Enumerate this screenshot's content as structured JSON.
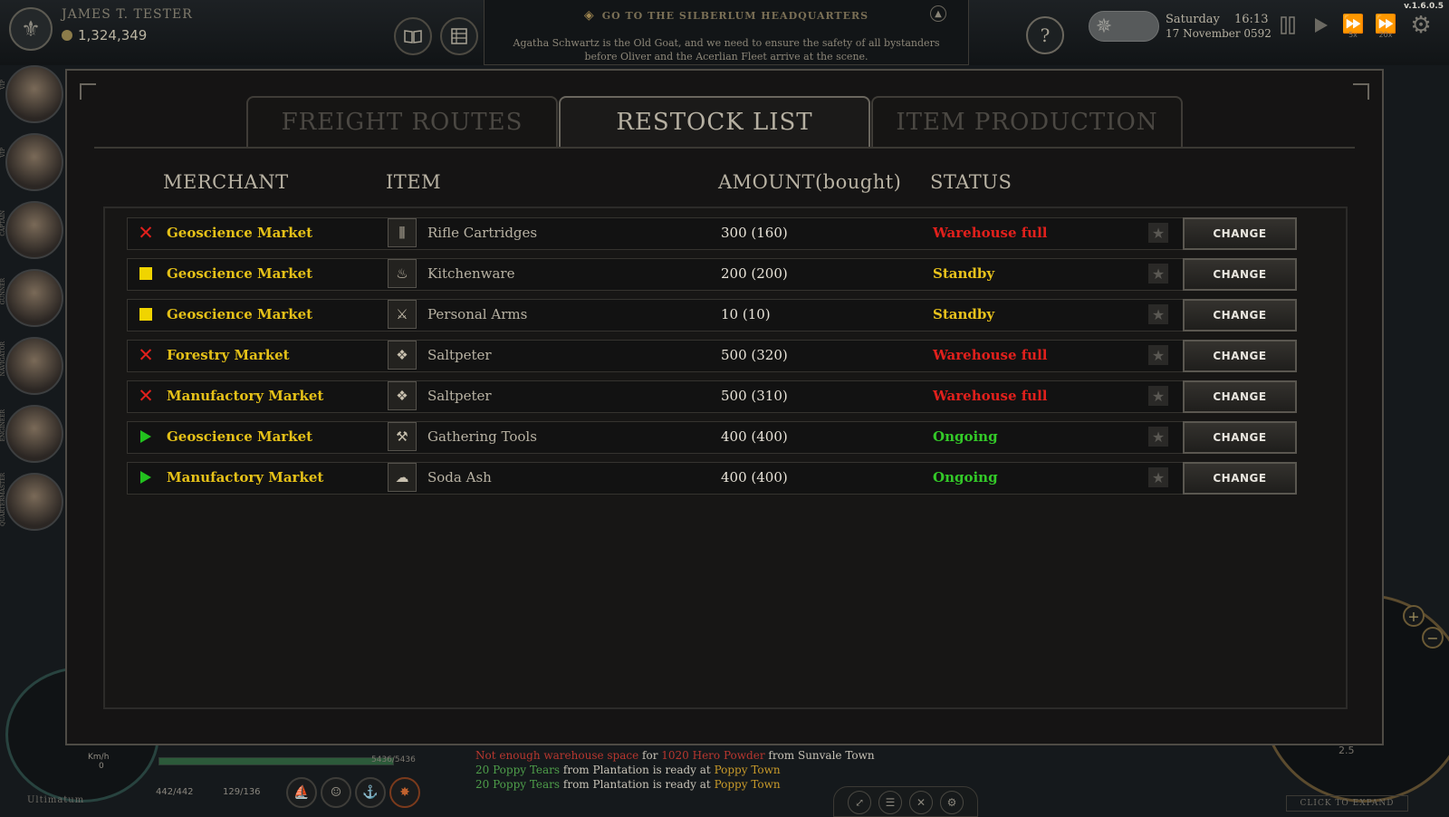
{
  "app": {
    "version": "v.1.6.0.5",
    "player_name": "JAMES T. TESTER",
    "money": "1,324,349"
  },
  "quest": {
    "title": "GO TO THE SILBERLUM HEADQUARTERS",
    "description": "Agatha Schwartz is the Old Goat, and we need to ensure the safety of all bystanders before Oliver and the Acerlian Fleet arrive at the scene."
  },
  "clock": {
    "day": "Saturday",
    "time": "16:13",
    "date": "17 November 0592",
    "speed_5x": "5x",
    "speed_20x": "20x"
  },
  "tabs": [
    {
      "label": "FREIGHT ROUTES",
      "active": false
    },
    {
      "label": "RESTOCK LIST",
      "active": true
    },
    {
      "label": "ITEM PRODUCTION",
      "active": false
    }
  ],
  "columns": {
    "merchant": "MERCHANT",
    "item": "ITEM",
    "amount": "AMOUNT(bought)",
    "status": "STATUS"
  },
  "rows": [
    {
      "state": "error",
      "merchant": "Geoscience Market",
      "item": "Rifle Cartridges",
      "item_icon": "cartridges-icon",
      "amount": "300 (160)",
      "status": "Warehouse full",
      "status_color": "#e1201c",
      "action": "CHANGE"
    },
    {
      "state": "standby",
      "merchant": "Geoscience Market",
      "item": "Kitchenware",
      "item_icon": "kitchenware-icon",
      "amount": "200 (200)",
      "status": "Standby",
      "status_color": "#e8c21c",
      "action": "CHANGE"
    },
    {
      "state": "standby",
      "merchant": "Geoscience Market",
      "item": "Personal Arms",
      "item_icon": "sword-icon",
      "amount": "10 (10)",
      "status": "Standby",
      "status_color": "#e8c21c",
      "action": "CHANGE"
    },
    {
      "state": "error",
      "merchant": "Forestry Market",
      "item": "Saltpeter",
      "item_icon": "saltpeter-icon",
      "amount": "500 (320)",
      "status": "Warehouse full",
      "status_color": "#e1201c",
      "action": "CHANGE"
    },
    {
      "state": "error",
      "merchant": "Manufactory Market",
      "item": "Saltpeter",
      "item_icon": "saltpeter-icon",
      "amount": "500 (310)",
      "status": "Warehouse full",
      "status_color": "#e1201c",
      "action": "CHANGE"
    },
    {
      "state": "ongoing",
      "merchant": "Geoscience Market",
      "item": "Gathering Tools",
      "item_icon": "tools-icon",
      "amount": "400 (400)",
      "status": "Ongoing",
      "status_color": "#33c928",
      "action": "CHANGE"
    },
    {
      "state": "ongoing",
      "merchant": "Manufactory Market",
      "item": "Soda Ash",
      "item_icon": "soda-ash-icon",
      "amount": "400 (400)",
      "status": "Ongoing",
      "status_color": "#33c928",
      "action": "CHANGE"
    }
  ],
  "hud": {
    "ship_name": "Ultimatum",
    "speed_unit": "Km/h",
    "speed_value": "0",
    "hull": "5436/5436",
    "hull_fraction": 1.0,
    "crew": "442/442",
    "cargo": "129/136",
    "zoom": "2.5",
    "expand_label": "CLICK TO EXPAND"
  },
  "log": [
    [
      {
        "t": "Not enough warehouse space",
        "c": "c-red"
      },
      {
        "t": " for ",
        "c": "c-white"
      },
      {
        "t": "1020 Hero Powder",
        "c": "c-red"
      },
      {
        "t": " from Sunvale Town",
        "c": "c-white"
      }
    ],
    [
      {
        "t": "20 Poppy Tears",
        "c": "c-green"
      },
      {
        "t": " from Plantation is ready at ",
        "c": "c-white"
      },
      {
        "t": "Poppy Town",
        "c": "c-orange"
      }
    ],
    [
      {
        "t": "20 Poppy Tears",
        "c": "c-green"
      },
      {
        "t": " from Plantation is ready at ",
        "c": "c-white"
      },
      {
        "t": "Poppy Town",
        "c": "c-orange"
      }
    ]
  ],
  "crew_roles": [
    "VIP",
    "VIP",
    "CAPTAIN",
    "GUNNER",
    "NAVIGATOR",
    "ENGINEER",
    "QUARTERMASTER"
  ],
  "icons": {
    "crest": "⚜",
    "help": "?",
    "star": "★"
  }
}
